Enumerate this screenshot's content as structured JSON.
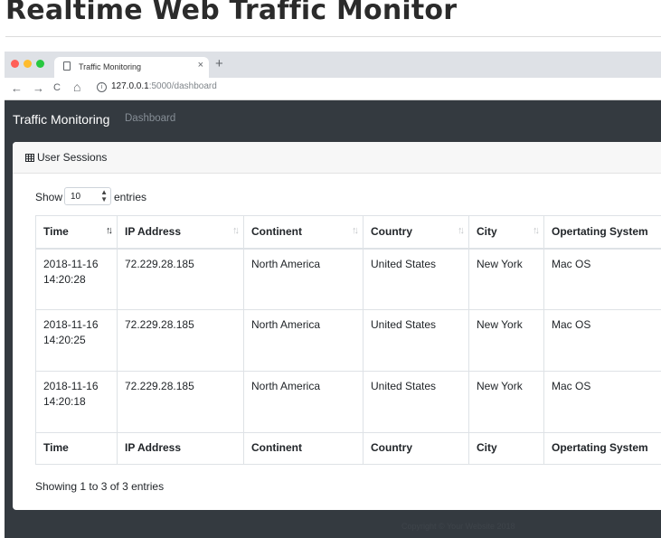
{
  "page": {
    "title": "Realtime Web Traffic Monitor"
  },
  "browser": {
    "tab_title": "Traffic Monitoring",
    "tab_close": "×",
    "new_tab": "+",
    "nav": {
      "back": "←",
      "forward": "→",
      "reload": "C",
      "home": "⌂"
    },
    "url_host": "127.0.0.1",
    "url_path": ":5000/dashboard"
  },
  "app": {
    "brand": "Traffic Monitoring",
    "nav_link": "Dashboard",
    "card_title": "User Sessions",
    "length": {
      "show": "Show",
      "value": "10",
      "entries": "entries"
    },
    "table": {
      "columns": [
        "Time",
        "IP Address",
        "Continent",
        "Country",
        "City",
        "Opertating System"
      ],
      "rows": [
        {
          "time_date": "2018-11-16",
          "time_clock": "14:20:28",
          "ip": "72.229.28.185",
          "continent": "North America",
          "country": "United States",
          "city": "New York",
          "os": "Mac OS"
        },
        {
          "time_date": "2018-11-16",
          "time_clock": "14:20:25",
          "ip": "72.229.28.185",
          "continent": "North America",
          "country": "United States",
          "city": "New York",
          "os": "Mac OS"
        },
        {
          "time_date": "2018-11-16",
          "time_clock": "14:20:18",
          "ip": "72.229.28.185",
          "continent": "North America",
          "country": "United States",
          "city": "New York",
          "os": "Mac OS"
        }
      ],
      "sort_icons": {
        "active": "↑↓",
        "inactive": "↑↓"
      }
    },
    "info": "Showing 1 to 3 of 3 entries",
    "footer": "Copyright © Your Website 2018"
  },
  "colors": {
    "navbar_bg": "#343a40",
    "tabstrip_bg": "#dee1e6",
    "card_header_bg": "#f7f7f7",
    "traffic_red": "#ff5f57",
    "traffic_yellow": "#febc2e",
    "traffic_green": "#28c840"
  }
}
